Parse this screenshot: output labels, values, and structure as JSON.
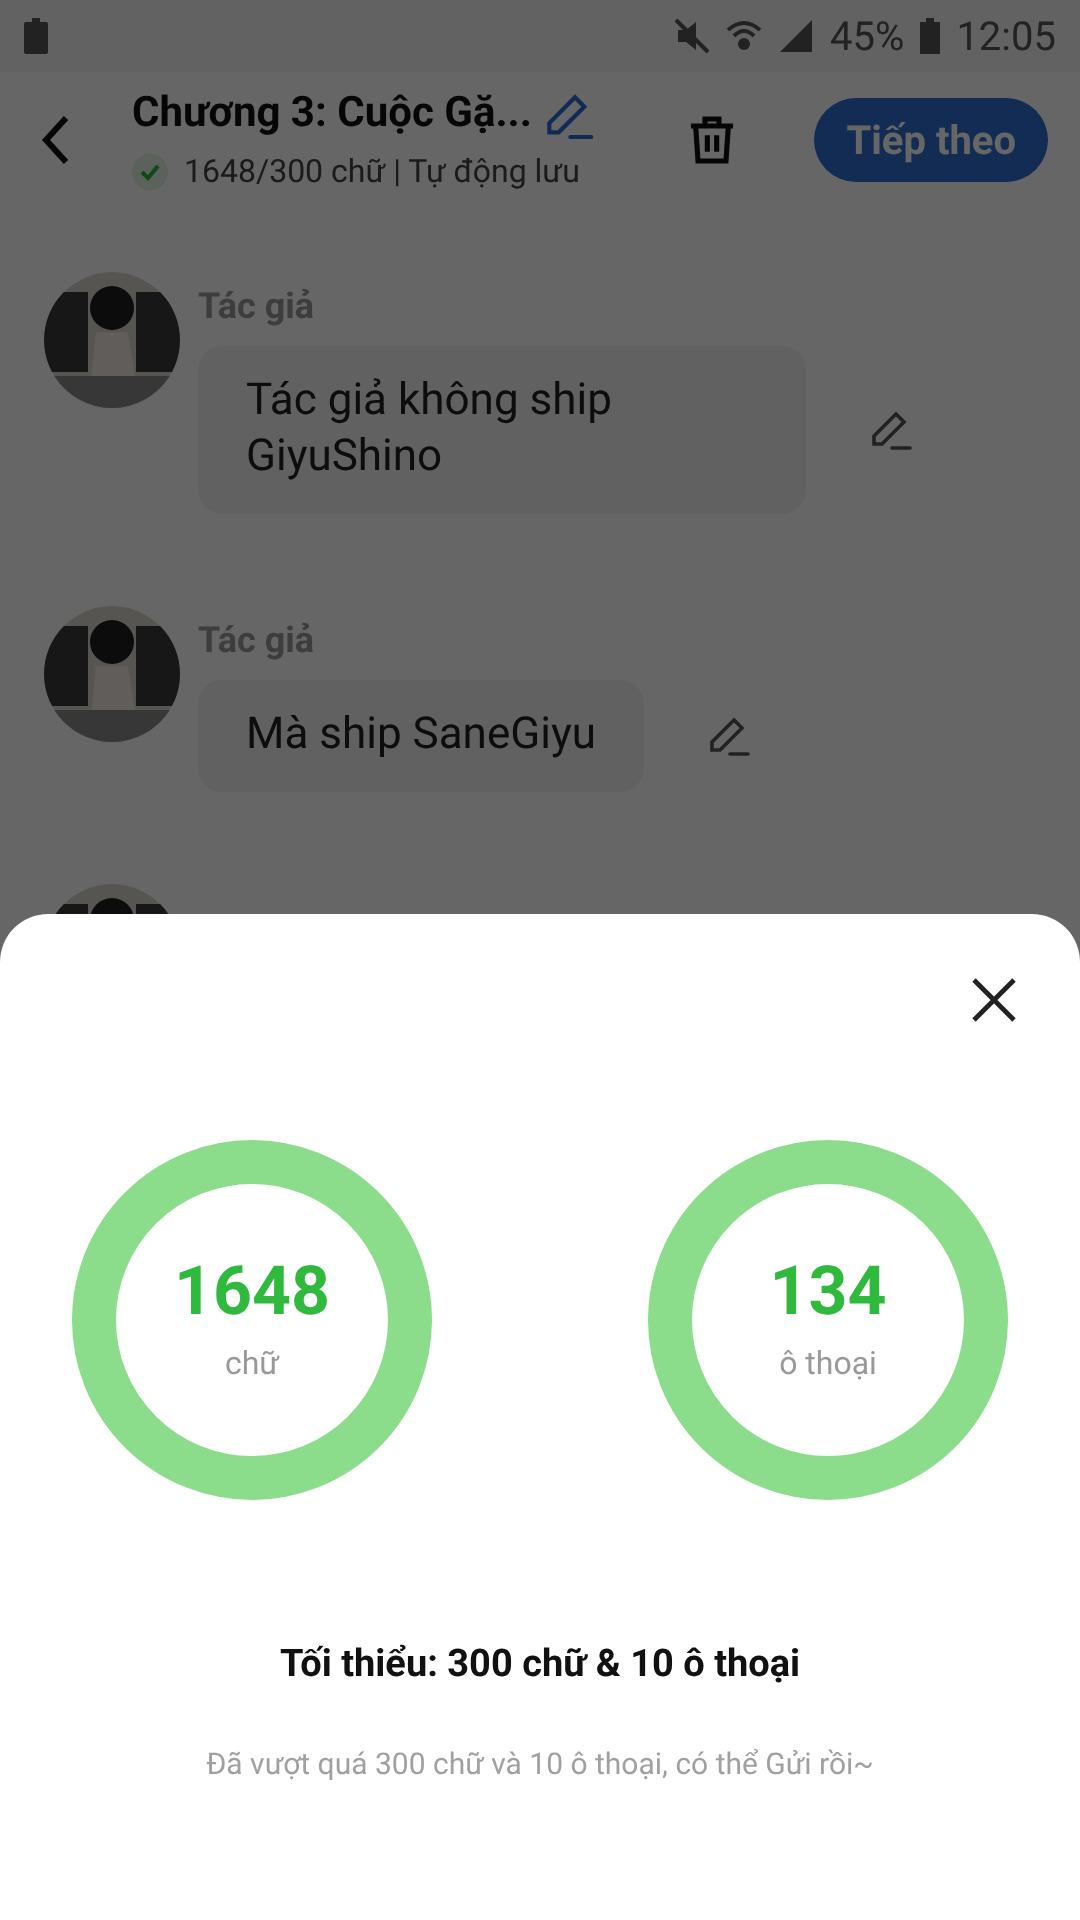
{
  "status_bar": {
    "battery_percent": "45%",
    "time": "12:05"
  },
  "header": {
    "title": "Chương 3: Cuộc Gặ...",
    "subtitle": "1648/300 chữ | Tự động lưu",
    "next_button": "Tiếp theo"
  },
  "messages": [
    {
      "author": "Tác giả",
      "text": "Tác giả không ship GiyuShino"
    },
    {
      "author": "Tác giả",
      "text": "Mà ship SaneGiyu"
    }
  ],
  "sheet": {
    "stats": [
      {
        "value": "1648",
        "label": "chữ"
      },
      {
        "value": "134",
        "label": "ô thoại"
      }
    ],
    "minimum": "Tối thiểu: 300 chữ & 10 ô thoại",
    "note": "Đã vượt quá 300 chữ và 10 ô thoại, có thể Gửi rồi~"
  }
}
